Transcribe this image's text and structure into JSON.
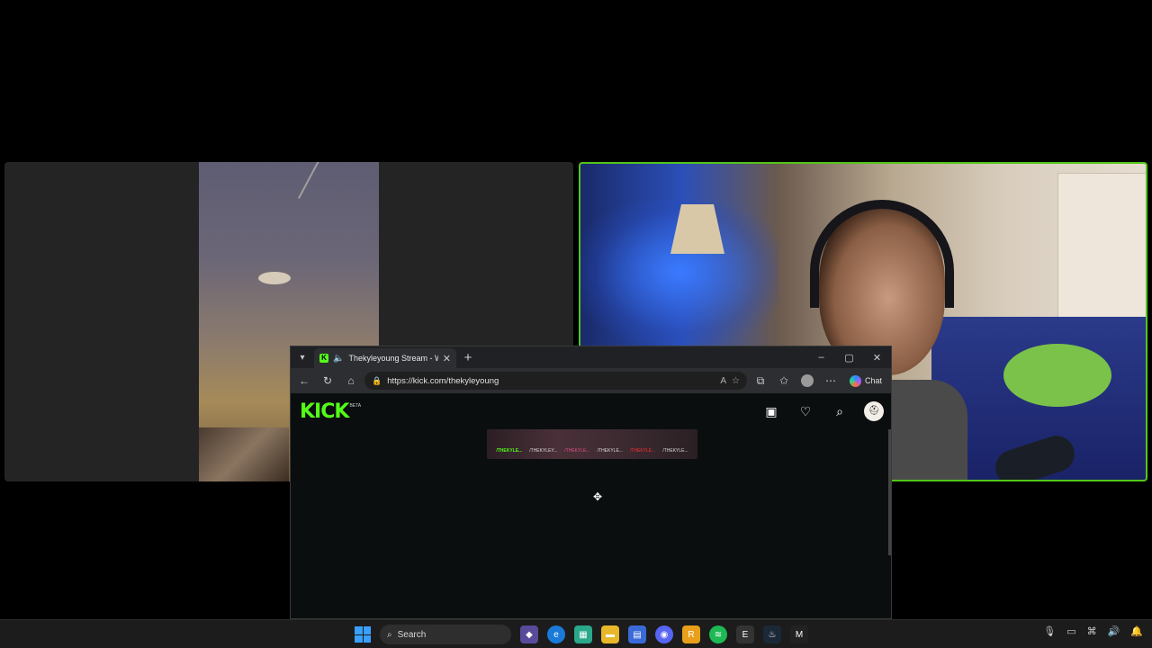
{
  "browser": {
    "tab_title": "Thekyleyoung Stream - Watch",
    "url": "https://kick.com/thekyleyoung",
    "chat_label": "Chat",
    "read_aloud": "A",
    "controls": {
      "minimize": "–",
      "maximize": "▢",
      "close": "✕"
    }
  },
  "kick": {
    "logo": "KICK",
    "beta": "BETA",
    "avatar_initial": "⛑"
  },
  "banner_links": {
    "kick": "/THEKYLE...",
    "twitch": "/THEKYLEY...",
    "instagram": "/THEKYLE...",
    "tiktok": "/THEKYLE...",
    "youtube": "/THEKYLE...",
    "x": "/THEKYLE..."
  },
  "taskbar": {
    "search_label": "Search"
  },
  "colors": {
    "kick_green": "#53fc18",
    "active_speaker_border": "#53c51a"
  },
  "icons": [
    "tab-list-icon",
    "speaker-icon",
    "back-icon",
    "reload-icon",
    "home-icon",
    "lock-icon",
    "favorite-icon",
    "extensions-icon",
    "more-icon",
    "copilot-icon",
    "following-icon",
    "heart-icon",
    "search-icon",
    "windows-start-icon",
    "move-cursor-icon"
  ]
}
